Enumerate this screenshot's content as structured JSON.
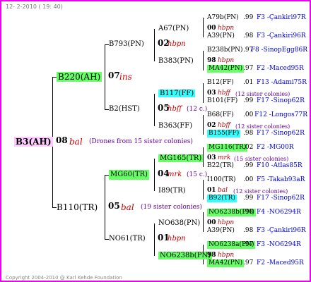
{
  "header": "12- 2-2010 ( 19: 40)",
  "copyright": "Copyright 2004-2010 @ Karl Kehde Foundation",
  "root": {
    "id": "B3(AH)",
    "gen": "08",
    "code": "bal",
    "note": "(Drones from 15 sister colonies)"
  },
  "p1": {
    "id": "B220(AH)",
    "gen": "07",
    "code": "ins"
  },
  "p2": {
    "id": "B110(TR)",
    "gen": "05",
    "code": "bal",
    "note": "(19 sister colonies)"
  },
  "l3": [
    {
      "id": "B793(PN)",
      "gen": "02",
      "code": "hbpn"
    },
    {
      "id": "B2(HST)",
      "gen": "05",
      "code": "hbff",
      "note": "(12 c.)"
    },
    {
      "id": "MG60(TR)",
      "gen": "04",
      "code": "mrk",
      "note": "(15 c.)"
    },
    {
      "id": "NO61(TR)",
      "gen": "01",
      "code": "hbpn"
    }
  ],
  "l4": [
    {
      "id": "A67(PN)",
      "gen": "00",
      "code": "hbpn"
    },
    {
      "id": "B383(PN)",
      "gen": "98",
      "code": "hbpn"
    },
    {
      "id": "B117(FF)",
      "gen": "03",
      "code": "hbff",
      "note": "(12 sister colonies)"
    },
    {
      "id": "B363(FF)",
      "gen": "02",
      "code": "hbff",
      "note": "(12 sister colonies)"
    },
    {
      "id": "MG165(TR)",
      "gen": "03",
      "code": "mrk",
      "note": "(15 sister colonies)"
    },
    {
      "id": "I89(TR)",
      "gen": "01",
      "code": "bal",
      "note": "(12 sister colonies)"
    },
    {
      "id": "NO638(PN)",
      "gen": "00",
      "code": "hbpn"
    },
    {
      "id": "NO6238b(PN)",
      "gen": "98",
      "code": "hbpn"
    }
  ],
  "l5": [
    {
      "id": "A79b(PN)",
      "val": ".99",
      "src": "F3 -Çankiri97R"
    },
    {
      "id": "A39(PN)",
      "val": ".98",
      "src": "F3 -Çankiri96R"
    },
    {
      "id": "B238b(PN)",
      "val": ".97",
      "src": "F8 -SinopEgg86R"
    },
    {
      "id": "MA42(PN)",
      "val": ".97",
      "src": "F2 -Maced95R"
    },
    {
      "id": "B12(FF)",
      "val": ".01",
      "src": "F13 -Adami75R"
    },
    {
      "id": "B101(FF)",
      "val": ".99",
      "src": "F17 -Sinop62R"
    },
    {
      "id": "B68(FF)",
      "val": ".00",
      "src": "F12 -Longos77R"
    },
    {
      "id": "B155(FF)",
      "val": ".98",
      "src": "F17 -Sinop62R"
    },
    {
      "id": "MG116(TR)",
      "val": ".02",
      "src": "F2 -MG00R"
    },
    {
      "id": "B22(TR)",
      "val": ".99",
      "src": "F10 -Atlas85R"
    },
    {
      "id": "I100(TR)",
      "val": ".00",
      "src": "F5 -Takab93aR"
    },
    {
      "id": "B92(TR)",
      "val": ".99",
      "src": "F17 -Sinop62R"
    },
    {
      "id": "NO6238b(PN)",
      "val": ".98",
      "src": "F4 -NO6294R"
    },
    {
      "id": "A39(PN)",
      "val": ".98",
      "src": "F3 -Çankiri96R"
    },
    {
      "id": "NO6238a(PN)",
      "val": ".97",
      "src": "F3 -NO6294R"
    },
    {
      "id": "MA42(PN)",
      "val": ".97",
      "src": "F2 -Maced95R"
    }
  ]
}
